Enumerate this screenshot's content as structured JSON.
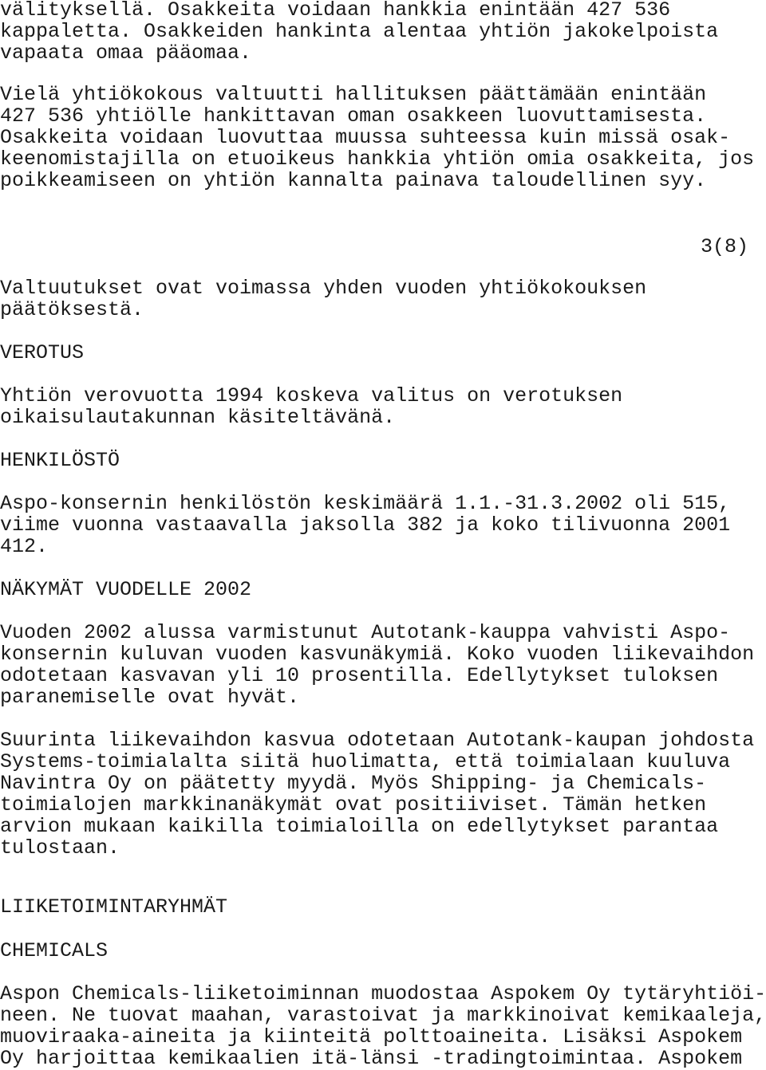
{
  "page_number": "3(8)",
  "blocks": [
    {
      "type": "paragraph",
      "lines": [
        "välityksellä. Osakkeita voidaan hankkia enintään 427 536",
        "kappaletta. Osakkeiden hankinta alentaa yhtiön jakokelpoista",
        "vapaata omaa pääomaa."
      ]
    },
    {
      "type": "paragraph",
      "lines": [
        "Vielä yhtiökokous valtuutti hallituksen päättämään enintään",
        "427 536 yhtiölle hankittavan oman osakkeen luovuttamisesta.",
        "Osakkeita voidaan luovuttaa muussa suhteessa kuin missä osak-",
        "keenomistajilla on etuoikeus hankkia yhtiön omia osakkeita, jos",
        "poikkeamiseen on yhtiön kannalta painava taloudellinen syy."
      ]
    },
    {
      "type": "paragraph",
      "lines": [
        "Valtuutukset ovat voimassa yhden vuoden yhtiökokouksen",
        "päätöksestä."
      ]
    },
    {
      "type": "heading",
      "lines": [
        "VEROTUS"
      ]
    },
    {
      "type": "paragraph",
      "lines": [
        "Yhtiön verovuotta 1994 koskeva valitus on verotuksen",
        "oikaisulautakunnan käsiteltävänä."
      ]
    },
    {
      "type": "heading",
      "lines": [
        "HENKILÖSTÖ"
      ]
    },
    {
      "type": "paragraph",
      "lines": [
        "Aspo-konsernin henkilöstön keskimäärä 1.1.-31.3.2002 oli 515,",
        "viime vuonna vastaavalla jaksolla 382 ja koko tilivuonna 2001",
        "412."
      ]
    },
    {
      "type": "heading",
      "lines": [
        "NÄKYMÄT VUODELLE 2002"
      ]
    },
    {
      "type": "paragraph",
      "lines": [
        "Vuoden 2002 alussa varmistunut Autotank-kauppa vahvisti Aspo-",
        "konsernin kuluvan vuoden kasvunäkymiä. Koko vuoden liikevaihdon",
        "odotetaan kasvavan yli 10 prosentilla. Edellytykset tuloksen",
        "paranemiselle ovat hyvät."
      ]
    },
    {
      "type": "paragraph",
      "lines": [
        "Suurinta liikevaihdon kasvua odotetaan Autotank-kaupan johdosta",
        "Systems-toimialalta siitä huolimatta, että toimialaan kuuluva",
        "Navintra Oy on päätetty myydä. Myös Shipping- ja Chemicals-",
        "toimialojen markkinanäkymät ovat positiiviset. Tämän hetken",
        "arvion mukaan kaikilla toimialoilla on edellytykset parantaa",
        "tulostaan."
      ]
    },
    {
      "type": "heading",
      "lines": [
        "LIIKETOIMINTARYHMÄT"
      ]
    },
    {
      "type": "heading",
      "lines": [
        "CHEMICALS"
      ]
    },
    {
      "type": "paragraph",
      "lines": [
        "Aspon Chemicals-liiketoiminnan muodostaa Aspokem Oy tytäryhtiöi-",
        "neen. Ne tuovat maahan, varastoivat ja markkinoivat kemikaaleja,",
        "muoviraaka-aineita ja kiinteitä polttoaineita. Lisäksi Aspokem",
        "Oy harjoittaa kemikaalien itä-länsi -tradingtoimintaa. Aspokem"
      ]
    }
  ]
}
